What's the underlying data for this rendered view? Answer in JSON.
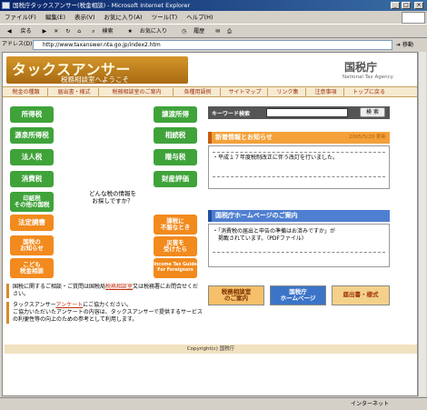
{
  "window": {
    "title": "国税庁タックスアンサー(税金相談) - Microsoft Internet Explorer",
    "status_zone": "インターネット"
  },
  "menu": [
    "ファイル(F)",
    "編集(E)",
    "表示(V)",
    "お気に入り(A)",
    "ツール(T)",
    "ヘルプ(H)"
  ],
  "toolbar": {
    "back": "戻る",
    "search": "検索",
    "favorites": "お気に入り",
    "history": "履歴"
  },
  "address": {
    "label": "アドレス(D)",
    "url": "http://www.taxanswer.nta.go.jp/index2.htm",
    "go": "移動"
  },
  "site": {
    "logo": "タックスアンサー",
    "logo_sub": "税務相談室へようこそ",
    "agency": "国税庁",
    "agency_en": "National Tax Agency"
  },
  "nav": [
    "税金の種類",
    "届出書・様式",
    "税務相談室のご案内",
    "各種用語例",
    "サイトマップ",
    "リンク集",
    "注意事項",
    "トップに戻る"
  ],
  "tax_buttons_left": [
    "所得税",
    "源泉所得税",
    "法人税",
    "消費税",
    "印紙税\nその他の国税"
  ],
  "tax_buttons_right": [
    "譲渡所得",
    "相続税",
    "贈与税",
    "財産評価"
  ],
  "orange_buttons_left": [
    "法定調書",
    "国税の\nお知らせ",
    "こども\n税金相談"
  ],
  "orange_buttons_right": [
    "課税に\n不服なとき",
    "災害を\n受けたら",
    "Income Tax Guide\nFor Foreigners"
  ],
  "center_text": "どんな税の情報を\nお探しですか？",
  "keyword": {
    "label": "キーワード検索",
    "button": "検 索"
  },
  "news": {
    "title": "新着情報とお知らせ",
    "date": "2005/5/20 更新",
    "item": "・平成１７年度税制改正に伴う改訂を行いました。"
  },
  "homepage_guide": {
    "title": "国税庁ホームページのご案内",
    "item": "・「消費税の届出と申告の準備はお済みですか」が\n　掲載されています。（PDFファイル）"
  },
  "banners": [
    "税務相談室\nのご案内",
    "国税庁\nホームページ",
    "届出書・様式"
  ],
  "notes": {
    "first_pre": "国税に関するご相談・ご質問は国税局",
    "first_link": "税務相談室",
    "first_post": "又は税務署にお問合せください。",
    "second_pre": "タックスアンサー",
    "second_link": "アンケート",
    "second_post": "にご協力ください。\nご協力いただいたアンケートの内容は、タックスアンサーで提供するサービスの利便性等の向上のための参考として利用します。"
  },
  "copyright": "Copyright(c) 国税庁",
  "colors": {
    "green": "#3fa33a",
    "orange": "#f28a1d",
    "header_brown": "#b8741a",
    "news_orange": "#f4a13a",
    "guide_blue": "#4f7fd1"
  }
}
